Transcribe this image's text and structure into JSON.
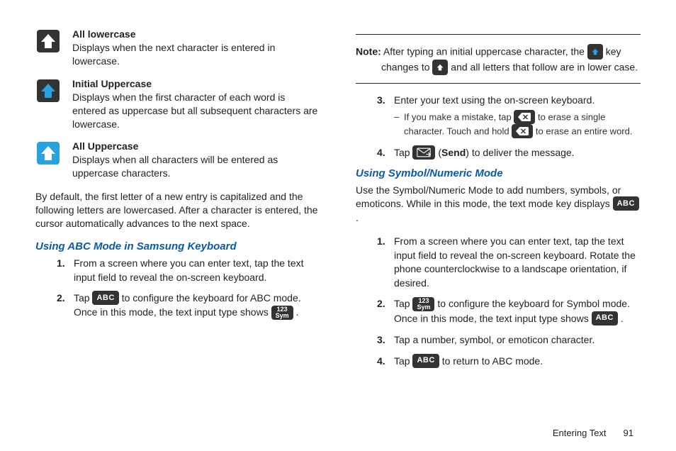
{
  "left": {
    "defs": [
      {
        "title": "All lowercase",
        "body": "Displays when the next character is entered in lowercase.",
        "fill": "#333333",
        "arrow": "#ffffff"
      },
      {
        "title": "Initial Uppercase",
        "body": "Displays when the first character of each word is entered as uppercase but all subsequent characters are lowercase.",
        "fill": "#333333",
        "arrow": "#29a3e0"
      },
      {
        "title": "All Uppercase",
        "body": "Displays when all characters will be entered as uppercase characters.",
        "fill": "#29a3e0",
        "arrow": "#ffffff"
      }
    ],
    "default_para": "By default, the first letter of a new entry is capitalized and the following letters are lowercased. After a character is entered, the cursor automatically advances to the next space.",
    "section_title": "Using ABC Mode in Samsung Keyboard",
    "steps": {
      "s1_num": "1.",
      "s1": "From a screen where you can enter text, tap the text input field to reveal the on-screen keyboard.",
      "s2_num": "2.",
      "s2a": "Tap ",
      "s2b": " to configure the keyboard for ABC mode. Once in this mode, the text input type shows ",
      "s2c": " ."
    }
  },
  "right": {
    "note": {
      "label": "Note:",
      "a": " After typing an initial uppercase character, the ",
      "b": " key changes to ",
      "c": " and all letters that follow are in lower case."
    },
    "cont_steps": {
      "s3_num": "3.",
      "s3": "Enter your text using the on-screen keyboard.",
      "sub_a": "If you make a mistake, tap ",
      "sub_b": " to erase a single character. Touch and hold ",
      "sub_c": " to erase an entire word.",
      "s4_num": "4.",
      "s4a": "Tap ",
      "s4b": " (",
      "s4c": "Send",
      "s4d": ") to deliver the message."
    },
    "section_title": "Using Symbol/Numeric Mode",
    "intro_a": "Use the Symbol/Numeric Mode to add numbers, symbols, or emoticons. While in this mode, the text mode key displays ",
    "intro_b": " .",
    "steps": {
      "s1_num": "1.",
      "s1": "From a screen where you can enter text, tap the text input field to reveal the on-screen keyboard. Rotate the phone counterclockwise to a landscape orientation, if desired.",
      "s2_num": "2.",
      "s2a": "Tap ",
      "s2b": " to configure the keyboard for Symbol mode. Once in this mode, the text input type shows ",
      "s2c": " .",
      "s3_num": "3.",
      "s3": "Tap a number, symbol, or emoticon character.",
      "s4_num": "4.",
      "s4a": "Tap ",
      "s4b": " to return to ABC mode."
    }
  },
  "keys": {
    "abc": "ABC",
    "sym_top": "123",
    "sym_bot": "Sym"
  },
  "footer": {
    "section": "Entering Text",
    "page": "91"
  }
}
